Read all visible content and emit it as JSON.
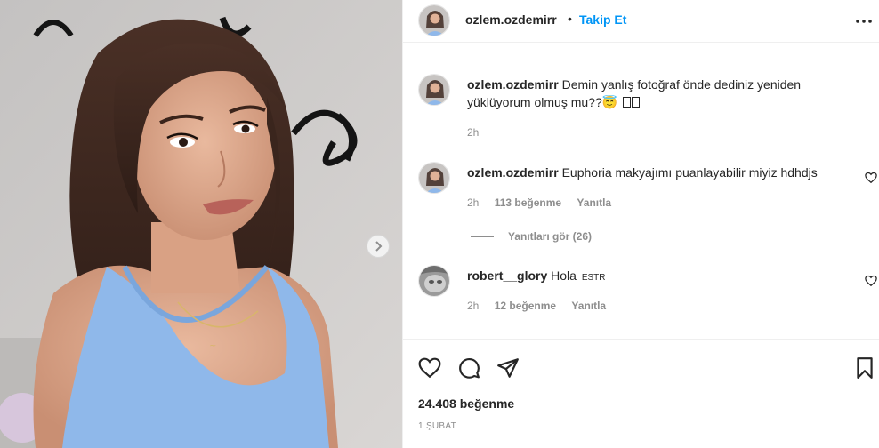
{
  "post": {
    "username": "ozlem.ozdemirr",
    "separator": "•",
    "follow_label": "Takip Et",
    "more_icon": "more-options-icon",
    "carousel_next_icon": "chevron-right-icon"
  },
  "comments": [
    {
      "username": "ozlem.ozdemirr",
      "text": "Demin yanlış fotoğraf önde dediniz yeniden yüklüyorum olmuş mu??",
      "emoji": "😇",
      "time": "2h"
    },
    {
      "username": "ozlem.ozdemirr",
      "text": "Euphoria makyajımı puanlayabilir miyiz hdhdjs",
      "time": "2h",
      "likes": "113 beğenme",
      "reply_label": "Yanıtla",
      "view_replies": "Yanıtları gör (26)"
    },
    {
      "username": "robert__glory",
      "text": "Hola",
      "badge": "ESTR",
      "time": "2h",
      "likes": "12 beğenme",
      "reply_label": "Yanıtla"
    }
  ],
  "footer": {
    "like_count": "24.408 beğenme",
    "date": "1 ŞUBAT"
  },
  "colors": {
    "accent": "#0095f6",
    "text": "#262626",
    "secondary": "#8e8e8e",
    "divider": "#efefef",
    "dress": "#8fb8ea"
  }
}
